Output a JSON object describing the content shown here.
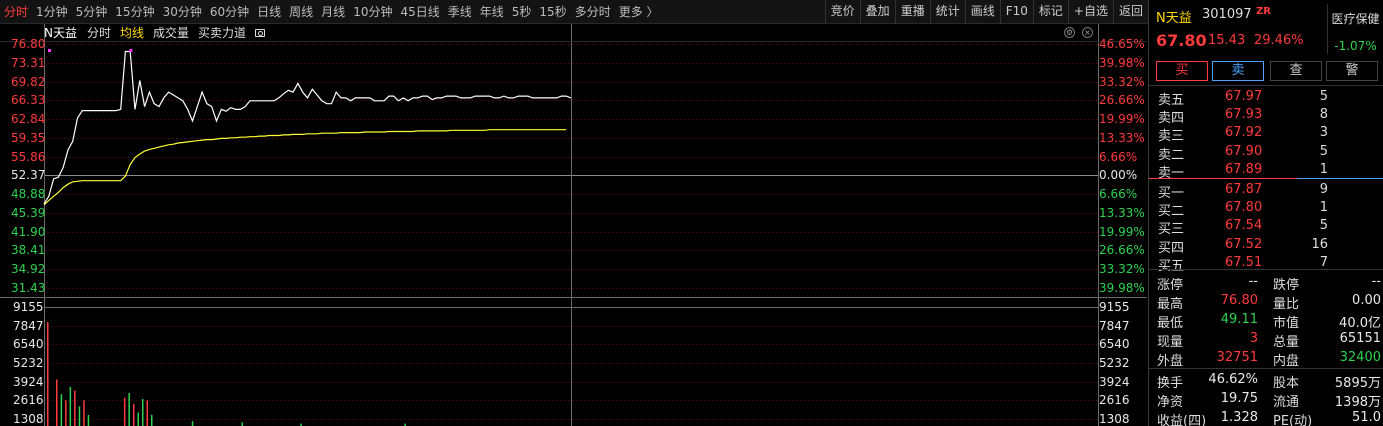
{
  "toolbar": {
    "tabs": [
      "分时",
      "1分钟",
      "5分钟",
      "15分钟",
      "30分钟",
      "60分钟",
      "日线",
      "周线",
      "月线",
      "10分钟",
      "45日线",
      "季线",
      "年线",
      "5秒",
      "15秒",
      "多分时",
      "更多 〉"
    ],
    "tools": [
      "竞价",
      "叠加",
      "重播",
      "统计",
      "画线",
      "F10",
      "标记",
      "+自选",
      "返回"
    ]
  },
  "chart_header": {
    "stock": "N天益",
    "items": [
      "分时",
      "均线",
      "成交量",
      "买卖力道"
    ]
  },
  "price_axis": {
    "left": [
      "76.80",
      "73.31",
      "69.82",
      "66.33",
      "62.84",
      "59.35",
      "55.86",
      "52.37",
      "48.88",
      "45.39",
      "41.90",
      "38.41",
      "34.92",
      "31.43"
    ],
    "right": [
      "46.65%",
      "39.98%",
      "33.32%",
      "26.66%",
      "19.99%",
      "13.33%",
      "6.66%",
      "0.00%",
      "6.66%",
      "13.33%",
      "19.99%",
      "26.66%",
      "33.32%",
      "39.98%"
    ]
  },
  "volume_axis": [
    "9155",
    "7847",
    "6540",
    "5232",
    "3924",
    "2616",
    "1308"
  ],
  "quote": {
    "name": "N天益",
    "code": "301097",
    "badge": "ZR",
    "price": "67.80",
    "change": "15.43",
    "change_pct": "29.46%",
    "industry": "医疗保健",
    "industry_change": "-1.07%",
    "buttons": [
      "买",
      "卖",
      "查",
      "警"
    ]
  },
  "order_book": {
    "asks": [
      {
        "label": "卖五",
        "price": "67.97",
        "vol": "5"
      },
      {
        "label": "卖四",
        "price": "67.93",
        "vol": "8"
      },
      {
        "label": "卖三",
        "price": "67.92",
        "vol": "3"
      },
      {
        "label": "卖二",
        "price": "67.90",
        "vol": "5"
      },
      {
        "label": "卖一",
        "price": "67.89",
        "vol": "1"
      }
    ],
    "bids": [
      {
        "label": "买一",
        "price": "67.87",
        "vol": "9"
      },
      {
        "label": "买二",
        "price": "67.80",
        "vol": "1"
      },
      {
        "label": "买三",
        "price": "67.54",
        "vol": "5"
      },
      {
        "label": "买四",
        "price": "67.52",
        "vol": "16"
      },
      {
        "label": "买五",
        "price": "67.51",
        "vol": "7"
      }
    ]
  },
  "stats": [
    {
      "k1": "涨停",
      "v1": "--",
      "c1": "white",
      "k2": "跌停",
      "v2": "--",
      "c2": "white"
    },
    {
      "k1": "最高",
      "v1": "76.80",
      "c1": "red",
      "k2": "量比",
      "v2": "0.00",
      "c2": "white"
    },
    {
      "k1": "最低",
      "v1": "49.11",
      "c1": "green",
      "k2": "市值",
      "v2": "40.0亿",
      "c2": "white"
    },
    {
      "k1": "现量",
      "v1": "3",
      "c1": "red",
      "k2": "总量",
      "v2": "65151",
      "c2": "white"
    },
    {
      "k1": "外盘",
      "v1": "32751",
      "c1": "red",
      "k2": "内盘",
      "v2": "32400",
      "c2": "green"
    },
    {
      "k1": "换手",
      "v1": "46.62%",
      "c1": "white",
      "k2": "股本",
      "v2": "5895万",
      "c2": "white"
    },
    {
      "k1": "净资",
      "v1": "19.75",
      "c1": "white",
      "k2": "流通",
      "v2": "1398万",
      "c2": "white"
    },
    {
      "k1": "收益(四)",
      "v1": "1.328",
      "c1": "white",
      "k2": "PE(动)",
      "v2": "51.0",
      "c2": "white"
    }
  ],
  "chart_data": {
    "type": "line",
    "prev_close": 52.37,
    "ylim": [
      31.43,
      76.8
    ],
    "series": [
      {
        "values": [
          49.2,
          50.5,
          53.5,
          53.8,
          55.5,
          58.5,
          60,
          64,
          65.3,
          65.3,
          65.3,
          65.3,
          65.3,
          65.3,
          65.3,
          65.3,
          65.5,
          75.5,
          75.5,
          65.5,
          70.5,
          66,
          68.5,
          66.5,
          66,
          67.5,
          68.5,
          68,
          67.5,
          67,
          65.5,
          63.5,
          66,
          68.5,
          66.5,
          66,
          63.5,
          65.5,
          65.2,
          65.8,
          65.5,
          65.5,
          66,
          67,
          67,
          67,
          67,
          67,
          67,
          67.5,
          68.2,
          68.8,
          68.5,
          70,
          68.5,
          67.5,
          69,
          68,
          67,
          66.5,
          66.5,
          68.5,
          67.5,
          67.5,
          67,
          67.5,
          67.5,
          67.5,
          67.5,
          67,
          67,
          67,
          67.8,
          67.8,
          67,
          67.5,
          67,
          67.5,
          67.5,
          67.8,
          67.8,
          67.2,
          67.5,
          67.5,
          67.8,
          67.8,
          67.8,
          67.5,
          67.5,
          67.5,
          67.8,
          67.8,
          67.8,
          67.8,
          67.5,
          67.5,
          67.8,
          67.5,
          67.5,
          67.8,
          67.8,
          67.8,
          67.5,
          67.5,
          67.5,
          67.5,
          67.5,
          67.5,
          67.8,
          67.8,
          67.5
        ]
      },
      {
        "values": [
          49.0,
          49.8,
          50.5,
          51.2,
          52.0,
          52.6,
          53.0,
          53.1,
          53.2,
          53.2,
          53.2,
          53.2,
          53.2,
          53.2,
          53.2,
          53.2,
          53.2,
          54.0,
          56.0,
          57.2,
          57.8,
          58.3,
          58.6,
          58.8,
          59.0,
          59.2,
          59.4,
          59.5,
          59.7,
          59.8,
          59.9,
          60.0,
          60.1,
          60.2,
          60.3,
          60.3,
          60.4,
          60.5,
          60.5,
          60.6,
          60.6,
          60.7,
          60.7,
          60.8,
          60.8,
          60.9,
          60.9,
          61.0,
          61.0,
          61.0,
          61.1,
          61.1,
          61.2,
          61.2,
          61.2,
          61.3,
          61.3,
          61.3,
          61.4,
          61.4,
          61.4,
          61.4,
          61.5,
          61.5,
          61.5,
          61.5,
          61.5,
          61.6,
          61.6,
          61.6,
          61.6,
          61.6,
          61.7,
          61.7,
          61.7,
          61.7,
          61.7,
          61.7,
          61.8,
          61.8,
          61.8,
          61.8,
          61.8,
          61.8,
          61.8,
          61.9,
          61.9,
          61.9,
          61.9,
          61.9,
          61.9,
          61.9,
          61.9,
          62.0,
          62.0,
          62.0,
          62.0,
          62.0,
          62.0,
          62.0,
          62.0,
          62.0,
          62.0,
          62.0,
          62.0,
          62.0,
          62.0,
          62.0,
          62.0,
          62.0
        ]
      }
    ],
    "volume": {
      "ylim": [
        0,
        9155
      ],
      "values": [
        8500,
        0,
        3800,
        2600,
        2100,
        3200,
        2900,
        1600,
        2100,
        900,
        0,
        0,
        0,
        0,
        0,
        0,
        0,
        2300,
        2700,
        1800,
        1100,
        2200,
        2100,
        900,
        0,
        0,
        0,
        0,
        0,
        0,
        0,
        0,
        400,
        0,
        0,
        0,
        0,
        0,
        0,
        0,
        0,
        0,
        0,
        300,
        0,
        0,
        0,
        0,
        0,
        0,
        0,
        0,
        0,
        0,
        0,
        0,
        200,
        0,
        0,
        0,
        0,
        0,
        0,
        0,
        0,
        0,
        0,
        0,
        0,
        0,
        0,
        0,
        0,
        0,
        0,
        0,
        0,
        0,
        0,
        200,
        0,
        0,
        0,
        0,
        0,
        0,
        0,
        0,
        0,
        0,
        0,
        0,
        0,
        0,
        0,
        0,
        0,
        0,
        0,
        0,
        0,
        0,
        0,
        0,
        0,
        0,
        0,
        0,
        0,
        0,
        0,
        0,
        0,
        0
      ],
      "directions": [
        "up",
        "up",
        "up",
        "down",
        "up",
        "down",
        "up",
        "down",
        "up",
        "down",
        "up",
        "up",
        "up",
        "up",
        "up",
        "up",
        "up",
        "up",
        "down",
        "up",
        "down",
        "down",
        "up",
        "down",
        "up",
        "up",
        "up",
        "up",
        "up",
        "up",
        "up",
        "up",
        "down",
        "up",
        "up",
        "up",
        "up",
        "up",
        "up",
        "up",
        "up",
        "up",
        "up",
        "down",
        "up",
        "up",
        "up",
        "up",
        "up",
        "up",
        "up",
        "up",
        "up",
        "up",
        "up",
        "up",
        "down",
        "up",
        "up",
        "up",
        "up",
        "up",
        "up",
        "up",
        "up",
        "up",
        "up",
        "up",
        "up",
        "up",
        "up",
        "up",
        "up",
        "up",
        "up",
        "up",
        "up",
        "up",
        "up",
        "down",
        "up",
        "up",
        "up",
        "up",
        "up",
        "up",
        "up",
        "up",
        "up",
        "up",
        "up",
        "up",
        "up",
        "up",
        "up",
        "up",
        "up",
        "up",
        "up",
        "up",
        "up",
        "up",
        "up",
        "up",
        "up",
        "up",
        "up",
        "up",
        "up",
        "up",
        "up",
        "up",
        "up",
        "up"
      ]
    },
    "markers": [
      0,
      17
    ]
  },
  "colors": {
    "up": "#ff3b3b",
    "down": "#2fd24f",
    "price_line": "#ffffff",
    "avg_line": "#ffff33",
    "grid": "#3a0a0a",
    "axis_line": "#6a6a6a"
  }
}
